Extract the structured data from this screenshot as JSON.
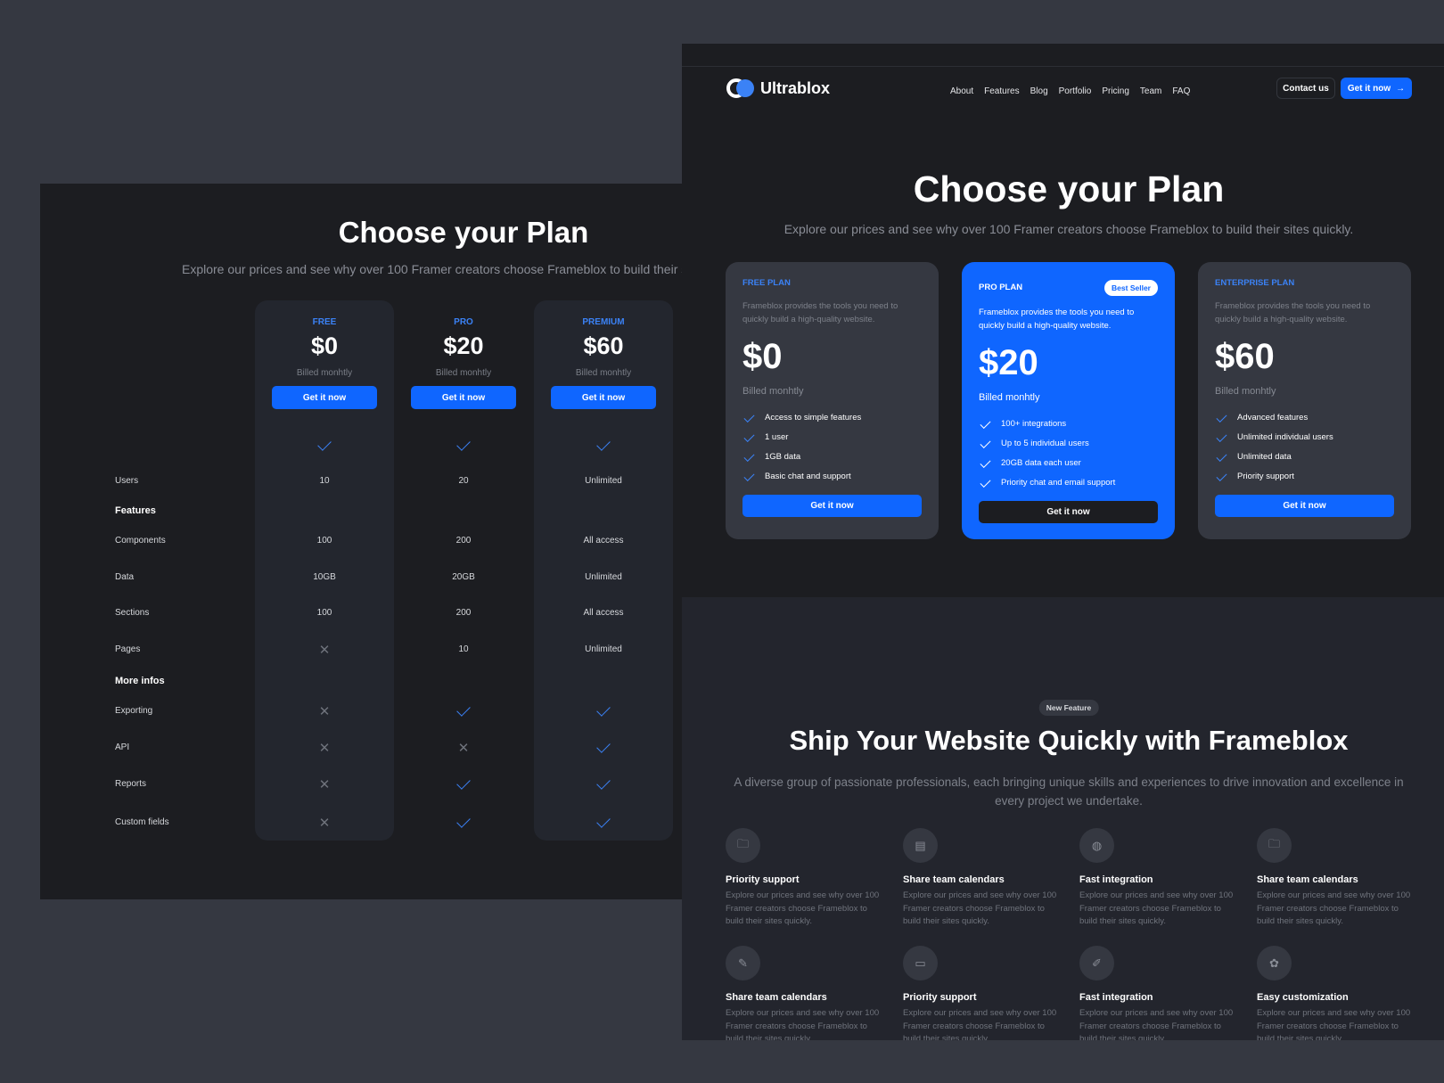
{
  "left": {
    "title": "Choose your Plan",
    "subtitle": "Explore our prices and see why over 100 Framer creators choose Frameblox to build their sites quickly.",
    "plans": [
      {
        "name": "FREE",
        "price": "$0",
        "billing": "Billed monhtly",
        "cta": "Get it now"
      },
      {
        "name": "PRO",
        "price": "$20",
        "billing": "Billed monhtly",
        "cta": "Get it now"
      },
      {
        "name": "PREMIUM",
        "price": "$60",
        "billing": "Billed monhtly",
        "cta": "Get it now"
      }
    ],
    "rows": [
      {
        "label": "",
        "values": [
          "check",
          "check",
          "check"
        ]
      },
      {
        "label": "Users",
        "values": [
          "10",
          "20",
          "Unlimited"
        ]
      },
      {
        "heading": "Features"
      },
      {
        "label": "Components",
        "values": [
          "100",
          "200",
          "All access"
        ]
      },
      {
        "label": "Data",
        "values": [
          "10GB",
          "20GB",
          "Unlimited"
        ]
      },
      {
        "label": "Sections",
        "values": [
          "100",
          "200",
          "All access"
        ]
      },
      {
        "label": "Pages",
        "values": [
          "cross",
          "10",
          "Unlimited"
        ]
      },
      {
        "heading": "More infos"
      },
      {
        "label": "Exporting",
        "values": [
          "cross",
          "check",
          "check"
        ]
      },
      {
        "label": "API",
        "values": [
          "cross",
          "cross",
          "check"
        ]
      },
      {
        "label": "Reports",
        "values": [
          "cross",
          "check",
          "check"
        ]
      },
      {
        "label": "Custom fields",
        "values": [
          "cross",
          "check",
          "check"
        ]
      }
    ]
  },
  "right": {
    "brand": "Ultrablox",
    "nav": [
      "About",
      "Features",
      "Blog",
      "Portfolio",
      "Pricing",
      "Team",
      "FAQ"
    ],
    "contact": "Contact us",
    "cta": "Get it now",
    "title": "Choose your Plan",
    "subtitle": "Explore our prices and see why over 100 Framer creators choose Frameblox to build their sites quickly.",
    "plans": [
      {
        "name": "FREE PLAN",
        "desc": "Frameblox provides the tools you need to quickly build a high-quality website.",
        "price": "$0",
        "billing": "Billed monhtly",
        "features": [
          "Access to simple features",
          "1 user",
          "1GB data",
          "Basic chat and support"
        ],
        "cta": "Get it now"
      },
      {
        "name": "PRO PLAN",
        "badge": "Best Seller",
        "desc": "Frameblox provides the tools you need to quickly build a high-quality website.",
        "price": "$20",
        "billing": "Billed monhtly",
        "features": [
          "100+ integrations",
          "Up to 5 individual users",
          "20GB data each user",
          "Priority chat and email support"
        ],
        "cta": "Get it now"
      },
      {
        "name": "ENTERPRISE PLAN",
        "desc": "Frameblox provides the tools you need to quickly build a high-quality website.",
        "price": "$60",
        "billing": "Billed monhtly",
        "features": [
          "Advanced features",
          "Unlimited individual users",
          "Unlimited data",
          "Priority support"
        ],
        "cta": "Get it now"
      }
    ],
    "section": {
      "badge": "New Feature",
      "title": "Ship Your Website Quickly with Frameblox",
      "subtitle": "A diverse group of passionate professionals, each bringing unique skills and experiences to drive innovation and excellence in every project we undertake.",
      "features": [
        {
          "icon": "folder-icon",
          "title": "Priority support",
          "desc": "Explore our prices and see why over 100 Framer creators choose Frameblox to build their sites quickly."
        },
        {
          "icon": "layout-icon",
          "title": "Share team calendars",
          "desc": "Explore our prices and see why over 100 Framer creators choose Frameblox to build their sites quickly."
        },
        {
          "icon": "globe-icon",
          "title": "Fast integration",
          "desc": "Explore our prices and see why over 100 Framer creators choose Frameblox to build their sites quickly."
        },
        {
          "icon": "folder-icon",
          "title": "Share team calendars",
          "desc": "Explore our prices and see why over 100 Framer creators choose Frameblox to build their sites quickly."
        },
        {
          "icon": "pin-icon",
          "title": "Share team calendars",
          "desc": "Explore our prices and see why over 100 Framer creators choose Frameblox to build their sites quickly."
        },
        {
          "icon": "monitor-icon",
          "title": "Priority support",
          "desc": "Explore our prices and see why over 100 Framer creators choose Frameblox to build their sites quickly."
        },
        {
          "icon": "pencil-icon",
          "title": "Fast integration",
          "desc": "Explore our prices and see why over 100 Framer creators choose Frameblox to build their sites quickly."
        },
        {
          "icon": "paw-icon",
          "title": "Easy customization",
          "desc": "Explore our prices and see why over 100 Framer creators choose Frameblox to build their sites quickly."
        }
      ]
    }
  },
  "colors": {
    "accent": "#0f66ff",
    "background": "#1c1d21",
    "card": "#353841"
  }
}
